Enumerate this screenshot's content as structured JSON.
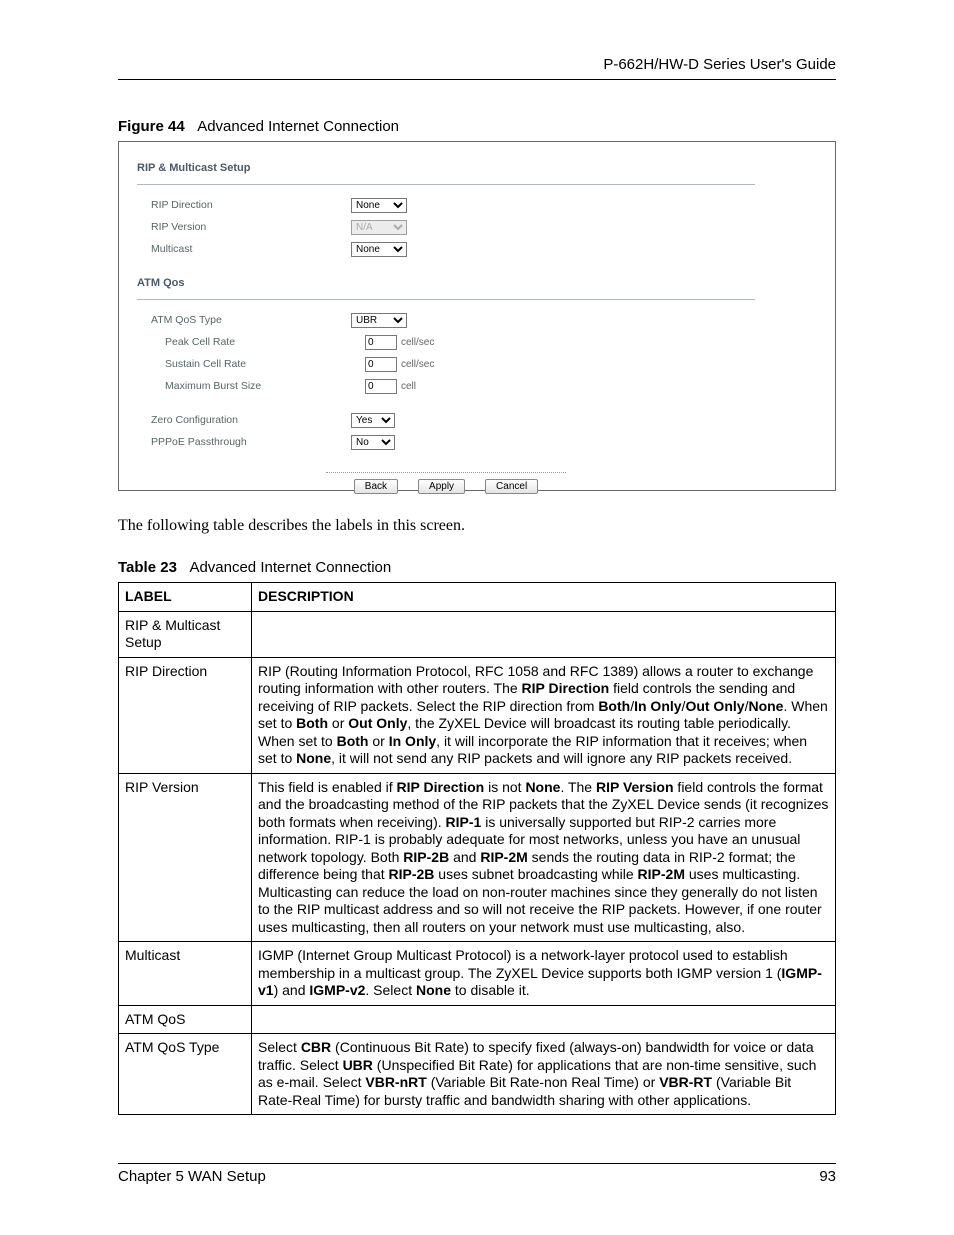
{
  "header": {
    "guide": "P-662H/HW-D Series User's Guide"
  },
  "figure": {
    "label": "Figure 44",
    "title": "Advanced Internet Connection"
  },
  "panel": {
    "section1_title": "RIP & Multicast Setup",
    "rip_direction_label": "RIP Direction",
    "rip_direction_value": "None",
    "rip_version_label": "RIP Version",
    "rip_version_value": "N/A",
    "multicast_label": "Multicast",
    "multicast_value": "None",
    "section2_title": "ATM Qos",
    "atm_qos_type_label": "ATM QoS Type",
    "atm_qos_type_value": "UBR",
    "peak_label": "Peak Cell Rate",
    "peak_value": "0",
    "peak_unit": "cell/sec",
    "sustain_label": "Sustain Cell Rate",
    "sustain_value": "0",
    "sustain_unit": "cell/sec",
    "mbs_label": "Maximum Burst Size",
    "mbs_value": "0",
    "mbs_unit": "cell",
    "zero_label": "Zero Configuration",
    "zero_value": "Yes",
    "pppoe_label": "PPPoE Passthrough",
    "pppoe_value": "No",
    "btn_back": "Back",
    "btn_apply": "Apply",
    "btn_cancel": "Cancel"
  },
  "intro": "The following table describes the labels in this screen.",
  "table": {
    "caption_label": "Table 23",
    "caption_title": "Advanced Internet Connection",
    "col1": "LABEL",
    "col2": "DESCRIPTION",
    "rows": {
      "r0": {
        "label": "RIP & Multicast Setup",
        "desc": ""
      },
      "r1": {
        "label": "RIP Direction"
      },
      "r2": {
        "label": "RIP Version"
      },
      "r3": {
        "label": "Multicast"
      },
      "r4": {
        "label": "ATM QoS",
        "desc": ""
      },
      "r5": {
        "label": "ATM QoS Type"
      }
    },
    "r1parts": {
      "t0": "RIP (Routing Information Protocol, RFC 1058 and RFC 1389) allows a router to exchange routing information with other routers. The ",
      "b0": "RIP Direction",
      "t1": " field controls the sending and receiving of RIP packets. Select the RIP direction from ",
      "b1": "Both",
      "s1": "/",
      "b2": "In Only",
      "s2": "/",
      "b3": "Out Only",
      "s3": "/",
      "b4": "None",
      "t2": ". When set to ",
      "b5": "Both",
      "t3": " or ",
      "b6": "Out Only",
      "t4": ", the ZyXEL Device will broadcast its routing table periodically. When set to ",
      "b7": "Both",
      "t5": " or ",
      "b8": "In Only",
      "t6": ", it will incorporate the RIP information that it receives; when set to ",
      "b9": "None",
      "t7": ", it will not send any RIP packets and will ignore any RIP packets received."
    },
    "r2parts": {
      "t0": "This field is enabled if ",
      "b0": "RIP Direction",
      "t1": " is not ",
      "b1": "None",
      "t2": ". The ",
      "b2": "RIP Version",
      "t3": " field controls the format and the broadcasting method of the RIP packets that the ZyXEL Device sends (it recognizes both formats when receiving). ",
      "b3": "RIP-1",
      "t4": " is universally supported but RIP-2 carries more information. RIP-1 is probably adequate for most networks, unless you have an unusual network topology. Both ",
      "b4": "RIP-2B",
      "t5": " and ",
      "b5": "RIP-2M",
      "t6": " sends the routing data in RIP-2 format; the difference being that ",
      "b6": "RIP-2B",
      "t7": " uses subnet broadcasting while ",
      "b7": "RIP-2M",
      "t8": " uses multicasting. Multicasting can reduce the load on non-router machines since they generally do not listen to the RIP multicast address and so will not receive the RIP packets. However, if one router uses multicasting, then all routers on your network must use multicasting, also."
    },
    "r3parts": {
      "t0": "IGMP (Internet Group Multicast Protocol) is a network-layer protocol used to establish membership in a multicast group. The ZyXEL Device supports both IGMP version 1 (",
      "b0": "IGMP-v1",
      "t1": ") and ",
      "b1": "IGMP-v2",
      "t2": ". Select ",
      "b2": "None",
      "t3": " to disable it."
    },
    "r5parts": {
      "t0": "Select ",
      "b0": "CBR",
      "t1": " (Continuous Bit Rate) to specify fixed (always-on) bandwidth for voice or data traffic. Select ",
      "b1": "UBR",
      "t2": " (Unspecified Bit Rate) for applications that are non-time sensitive, such as e-mail. Select ",
      "b2": "VBR-nRT",
      "t3": " (Variable Bit Rate-non Real Time) or ",
      "b3": "VBR-RT",
      "t4": " (Variable Bit Rate-Real Time) for bursty traffic and bandwidth sharing with other applications."
    }
  },
  "footer": {
    "chapter": "Chapter 5 WAN Setup",
    "page": "93"
  }
}
